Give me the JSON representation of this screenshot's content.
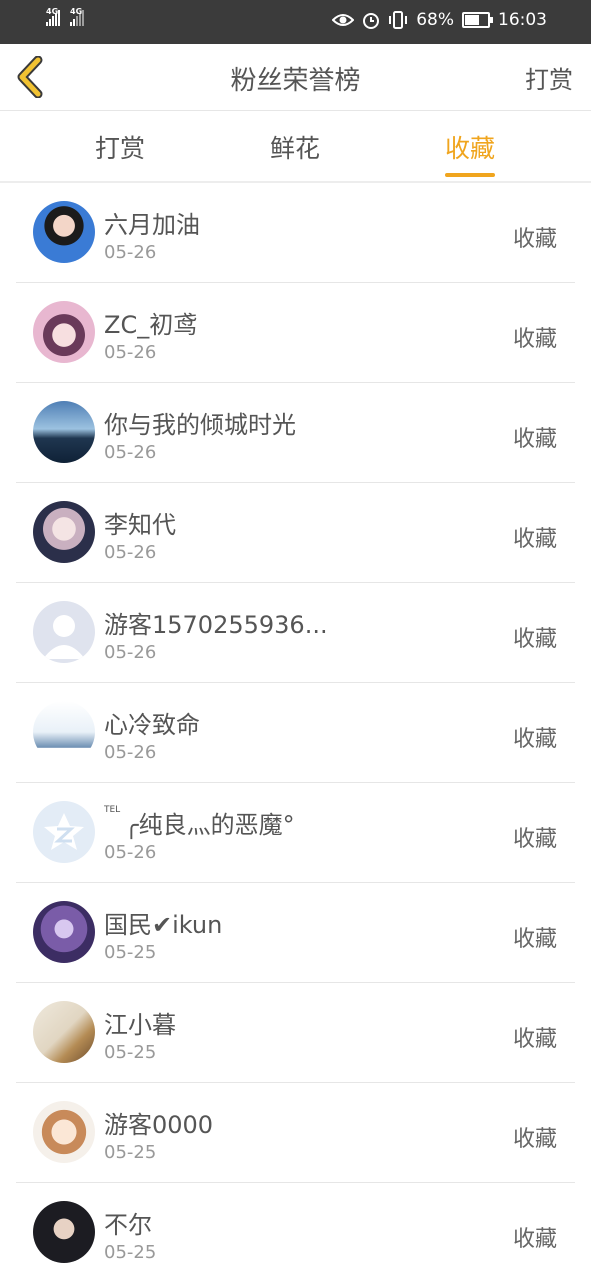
{
  "status_bar": {
    "signal_1": "4G",
    "signal_2": "4G",
    "battery": "68%",
    "battery_level": 0.68,
    "time": "16:03",
    "icons": [
      "eye-icon",
      "alarm-icon",
      "vibrate-icon",
      "battery-icon"
    ]
  },
  "header": {
    "title": "粉丝荣誉榜",
    "right_action": "打赏",
    "back_icon": "chevron-left-icon"
  },
  "tabs": [
    {
      "label": "打赏",
      "active": false
    },
    {
      "label": "鲜花",
      "active": false
    },
    {
      "label": "收藏",
      "active": true
    }
  ],
  "accent_color": "#f0a51e",
  "fans": [
    {
      "name": "六月加油",
      "date": "05-26",
      "action": "收藏"
    },
    {
      "name": "ZC_初鸢",
      "date": "05-26",
      "action": "收藏"
    },
    {
      "name": "你与我的倾城时光",
      "date": "05-26",
      "action": "收藏"
    },
    {
      "name": "李知代",
      "date": "05-26",
      "action": "收藏"
    },
    {
      "name": "游客1570255936...",
      "date": "05-26",
      "action": "收藏"
    },
    {
      "name": "心冷致命",
      "date": "05-26",
      "action": "收藏"
    },
    {
      "name_prefix": "TEL",
      "name": "╭纯良灬的恶魔°",
      "date": "05-26",
      "action": "收藏"
    },
    {
      "name": "国民✔ikun",
      "date": "05-25",
      "action": "收藏"
    },
    {
      "name": "江小暮",
      "date": "05-25",
      "action": "收藏"
    },
    {
      "name": "游客0000",
      "date": "05-25",
      "action": "收藏"
    },
    {
      "name": "不尔",
      "date": "05-25",
      "action": "收藏"
    }
  ]
}
